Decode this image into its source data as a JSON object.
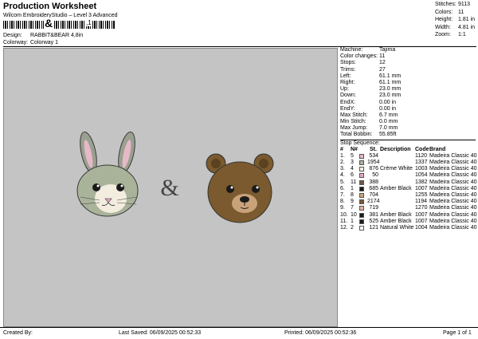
{
  "header": {
    "title": "Production Worksheet",
    "subtitle": "Wilcom EmbroideryStudio – Level 3 Advanced",
    "barcode_char": "&",
    "barcode_tail": ",1",
    "design_label": "Design:",
    "design_value": "RABBIT&BEAR 4,8in",
    "colorway_label": "Colorway:",
    "colorway_value": "Colorway 1"
  },
  "summary": [
    {
      "label": "Stitches:",
      "value": "9113"
    },
    {
      "label": "Colors:",
      "value": "11"
    },
    {
      "label": "Height:",
      "value": "1.81 in"
    },
    {
      "label": "Width:",
      "value": "4.81 in"
    },
    {
      "label": "Zoom:",
      "value": "1:1"
    }
  ],
  "canvas": {
    "amp": "&"
  },
  "stats": [
    {
      "label": "Machine:",
      "value": "Tajima"
    },
    {
      "label": "Color changes:",
      "value": "11"
    },
    {
      "label": "Stops:",
      "value": "12"
    },
    {
      "label": "Trims:",
      "value": "27"
    },
    {
      "label": "Left:",
      "value": "61.1 mm"
    },
    {
      "label": "Right:",
      "value": "61.1 mm"
    },
    {
      "label": "Up:",
      "value": "23.0 mm"
    },
    {
      "label": "Down:",
      "value": "23.0 mm"
    },
    {
      "label": "EndX:",
      "value": "0.00 in"
    },
    {
      "label": "EndY:",
      "value": "0.00 in"
    },
    {
      "label": "Max Stitch:",
      "value": "6.7 mm"
    },
    {
      "label": "Min Stitch:",
      "value": "0.0 mm"
    },
    {
      "label": "Max Jump:",
      "value": "7.0 mm"
    },
    {
      "label": "Total Bobbin:",
      "value": "55.85ft"
    }
  ],
  "stop_sequence": {
    "title": "Stop Sequence:",
    "headers": [
      "#",
      "N#",
      "St.",
      "Description",
      "Code",
      "Brand"
    ],
    "rows": [
      {
        "n": "1.",
        "nn": "5",
        "color": "#e6b8c8",
        "st": "534",
        "desc": "",
        "code": "1120",
        "brand": "Madeira Classic 40"
      },
      {
        "n": "2.",
        "nn": "3",
        "color": "#a9b39a",
        "st": "1954",
        "desc": "",
        "code": "1337",
        "brand": "Madeira Classic 40"
      },
      {
        "n": "3.",
        "nn": "4",
        "color": "#f3ede0",
        "st": "876",
        "desc": "Crème White",
        "code": "1003",
        "brand": "Madeira Classic 40"
      },
      {
        "n": "4.",
        "nn": "6",
        "color": "#e7a7c0",
        "st": "50",
        "desc": "",
        "code": "1054",
        "brand": "Madeira Classic 40"
      },
      {
        "n": "5.",
        "nn": "11",
        "color": "#6b5a4a",
        "st": "388",
        "desc": "",
        "code": "1382",
        "brand": "Madeira Classic 40"
      },
      {
        "n": "6.",
        "nn": "1",
        "color": "#1a1a1a",
        "st": "685",
        "desc": "Amber Black",
        "code": "1007",
        "brand": "Madeira Classic 40"
      },
      {
        "n": "7.",
        "nn": "8",
        "color": "#c9a27a",
        "st": "704",
        "desc": "",
        "code": "1255",
        "brand": "Madeira Classic 40"
      },
      {
        "n": "8.",
        "nn": "9",
        "color": "#7a5a2e",
        "st": "2174",
        "desc": "",
        "code": "1194",
        "brand": "Madeira Classic 40"
      },
      {
        "n": "9.",
        "nn": "7",
        "color": "#e0b49a",
        "st": "719",
        "desc": "",
        "code": "1270",
        "brand": "Madeira Classic 40"
      },
      {
        "n": "10.",
        "nn": "10",
        "color": "#1a1a1a",
        "st": "381",
        "desc": "Amber Black",
        "code": "1007",
        "brand": "Madeira Classic 40"
      },
      {
        "n": "11.",
        "nn": "1",
        "color": "#1a1a1a",
        "st": "525",
        "desc": "Amber Black",
        "code": "1007",
        "brand": "Madeira Classic 40"
      },
      {
        "n": "12.",
        "nn": "2",
        "color": "#ffffff",
        "st": "121",
        "desc": "Natural White",
        "code": "1004",
        "brand": "Madeira Classic 40"
      }
    ]
  },
  "footer": {
    "created": "Created By:",
    "saved": "Last Saved: 06/09/2025 00:52:33",
    "printed": "Printed: 06/09/2025 00:52:36",
    "page": "Page 1 of 1"
  }
}
